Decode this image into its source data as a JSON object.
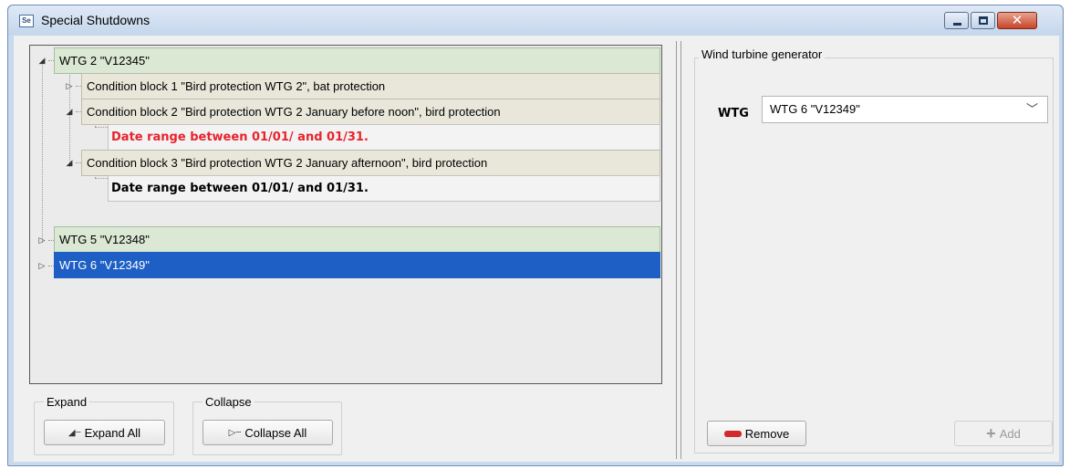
{
  "window": {
    "title": "Special Shutdowns",
    "app_icon_text": "Se"
  },
  "tree": {
    "nodes": [
      {
        "label": "WTG 2 \"V12345\"",
        "toggle": "◢"
      },
      {
        "label": "Condition block 1 \"Bird protection WTG 2\", bat protection",
        "toggle": "▷"
      },
      {
        "label": "Condition block 2 \"Bird protection WTG 2 January before noon\", bird protection",
        "toggle": "◢"
      },
      {
        "label": "Date range between 01/01/ and 01/31."
      },
      {
        "label": "Condition block 3 \"Bird protection WTG 2 January afternoon\", bird protection",
        "toggle": "◢"
      },
      {
        "label": "Date range between 01/01/ and 01/31."
      },
      {
        "label": "WTG 5 \"V12348\"",
        "toggle": "▷"
      },
      {
        "label": "WTG 6 \"V12349\"",
        "toggle": "▷"
      }
    ],
    "selected_index": 7,
    "error_color": "#e8232d",
    "selection_color": "#1d5fc4"
  },
  "expand_group": {
    "label": "Expand",
    "button": "Expand All"
  },
  "collapse_group": {
    "label": "Collapse",
    "button": "Collapse All"
  },
  "right": {
    "group_label": "Wind turbine generator",
    "field_label": "WTG",
    "field_value": "WTG 6 \"V12349\"",
    "remove_label": "Remove",
    "add_label": "Add"
  }
}
